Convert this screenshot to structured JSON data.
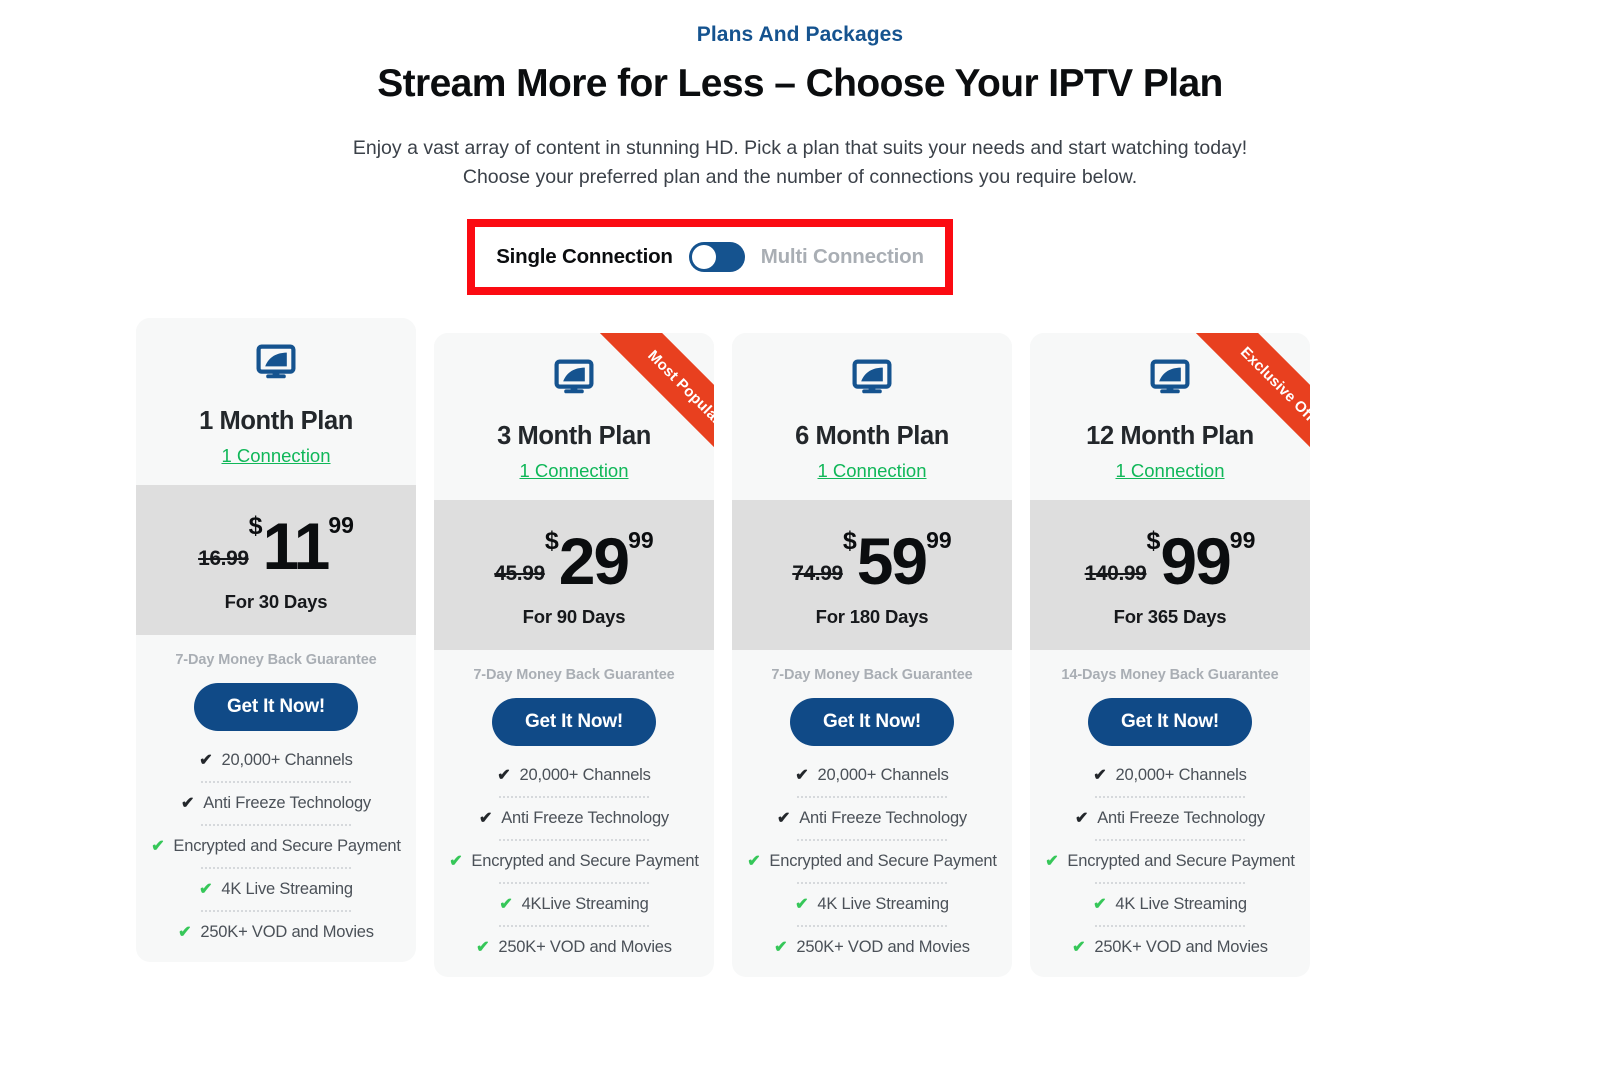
{
  "header": {
    "eyebrow": "Plans And Packages",
    "headline": "Stream More for Less – Choose Your IPTV Plan",
    "sub_line1": "Enjoy a vast array of content in stunning HD. Pick a plan that suits your needs and start watching today!",
    "sub_line2": "Choose your preferred plan and the number of connections you require below."
  },
  "toggle": {
    "left_label": "Single Connection",
    "right_label": "Multi Connection",
    "state": "single",
    "highlight_color": "#fb0b12",
    "track_color": "#15538f"
  },
  "colors": {
    "brand_blue": "#15538f",
    "cta_blue": "#104a87",
    "ribbon_orange": "#e8401f",
    "link_green": "#10b759",
    "check_green": "#36c759",
    "price_band_grey": "#dedede",
    "card_grey": "#f7f8f8"
  },
  "plans": [
    {
      "name": "1 Month Plan",
      "connections": "1 Connection",
      "old_price": "16.99",
      "currency": "$",
      "price": "11",
      "cents": "99",
      "duration": "For 30 Days",
      "guarantee": "7-Day Money Back Guarantee",
      "cta": "Get It Now!",
      "ribbon": null,
      "icon": "monitor-icon",
      "features": [
        {
          "label": "20,000+ Channels",
          "check": "dark"
        },
        {
          "label": "Anti Freeze Technology",
          "check": "dark"
        },
        {
          "label": "Encrypted and Secure Payment",
          "check": "green"
        },
        {
          "label": "4K Live Streaming",
          "check": "green"
        },
        {
          "label": "250K+ VOD and Movies",
          "check": "green"
        }
      ]
    },
    {
      "name": "3 Month Plan",
      "connections": "1 Connection",
      "old_price": "45.99",
      "currency": "$",
      "price": "29",
      "cents": "99",
      "duration": "For 90 Days",
      "guarantee": "7-Day Money Back Guarantee",
      "cta": "Get It Now!",
      "ribbon": "Most Popular!",
      "icon": "monitor-icon",
      "features": [
        {
          "label": "20,000+ Channels",
          "check": "dark"
        },
        {
          "label": "Anti Freeze Technology",
          "check": "dark"
        },
        {
          "label": "Encrypted and Secure Payment",
          "check": "green"
        },
        {
          "label": "4KLive Streaming",
          "check": "green"
        },
        {
          "label": "250K+ VOD and Movies",
          "check": "green"
        }
      ]
    },
    {
      "name": "6 Month Plan",
      "connections": "1 Connection",
      "old_price": "74.99",
      "currency": "$",
      "price": "59",
      "cents": "99",
      "duration": "For 180 Days",
      "guarantee": "7-Day Money Back Guarantee",
      "cta": "Get It Now!",
      "ribbon": null,
      "icon": "monitor-icon",
      "features": [
        {
          "label": "20,000+ Channels",
          "check": "dark"
        },
        {
          "label": "Anti Freeze Technology",
          "check": "dark"
        },
        {
          "label": "Encrypted and Secure Payment",
          "check": "green"
        },
        {
          "label": "4K Live Streaming",
          "check": "green"
        },
        {
          "label": "250K+ VOD and Movies",
          "check": "green"
        }
      ]
    },
    {
      "name": "12 Month Plan",
      "connections": "1 Connection",
      "old_price": "140.99",
      "currency": "$",
      "price": "99",
      "cents": "99",
      "duration": "For 365 Days",
      "guarantee": "14-Days Money Back Guarantee",
      "cta": "Get It Now!",
      "ribbon": "Exclusive Offer",
      "icon": "monitor-icon",
      "features": [
        {
          "label": "20,000+ Channels",
          "check": "dark"
        },
        {
          "label": "Anti Freeze Technology",
          "check": "dark"
        },
        {
          "label": "Encrypted and Secure Payment",
          "check": "green"
        },
        {
          "label": "4K Live Streaming",
          "check": "green"
        },
        {
          "label": "250K+ VOD and Movies",
          "check": "green"
        }
      ]
    }
  ]
}
